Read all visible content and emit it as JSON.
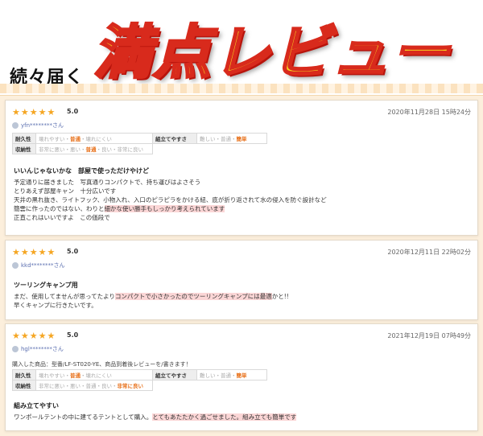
{
  "banner": {
    "lead": "続々届く",
    "title": "満点レビュー"
  },
  "reviews": [
    {
      "stars": "★★★★★",
      "rating": "5.0",
      "date": "2020年11月28日 15時24分",
      "user": "yfn********さん",
      "attributes": {
        "row1": {
          "label": "耐久性",
          "pre": "壊れやすい・",
          "selected": "普通",
          "post": "・壊れにくい",
          "label2": "組立てやすさ",
          "pre2": "難しい・普通・",
          "selected2": "簡単",
          "post2": ""
        },
        "row2": {
          "label": "収納性",
          "pre": "非常に悪い・悪い・",
          "selected": "普通",
          "post": "・良い・非常に良い"
        }
      },
      "body_title": "いいんじゃないかな　部屋で使っただけやけど",
      "lines": [
        "予定通りに届きました　写真通りコンパクトで、持ち運びはよさそう",
        "とりあえず部屋キャン　十分広いです",
        "天井の黒れ抜き、ライトフック、小物入れ、入口のピラピラをかける紐、底が折り返されて水の侵入を防ぐ設計など"
      ],
      "line4_pre": "簡雲に作ったのではない、わりと",
      "line4_hl": "細かな使い勝手もしっかり考えられています",
      "line5": "正直これはいいですよ　この価段で"
    },
    {
      "stars": "★★★★★",
      "rating": "5.0",
      "date": "2020年12月11日 22時02分",
      "user": "kkd********さん",
      "body_title": "ツーリングキャンプ用",
      "line1_pre": "まだ、使用してませんが思ってたより",
      "line1_hl": "コンパクトで小さかったのでツーリングキャンプには最適",
      "line1_post": "かと!!",
      "line2": "早くキャンプに行きたいです。"
    },
    {
      "stars": "★★★★★",
      "rating": "5.0",
      "date": "2021年12月19日 07時49分",
      "user": "hgl********さん",
      "purchased": "購入した商品：型番/LF-ST020-YE、商品到着後レビューを/書きます！",
      "attributes": {
        "row1": {
          "label": "耐久性",
          "pre": "壊れやすい・",
          "selected": "普通",
          "post": "・壊れにくい",
          "label2": "組立てやすさ",
          "pre2": "難しい・普通・",
          "selected2": "簡単",
          "post2": ""
        },
        "row2": {
          "label": "収納性",
          "pre": "非常に悪い・悪い・普通・良い・",
          "selected": "非常に良い",
          "post": ""
        }
      },
      "body_title": "組み立てやすい",
      "line1_pre": "ワンポールテントの中に建てるテントとして購入。",
      "line1_hl": "とてもあたたかく過ごせました。組み立ても簡単です"
    }
  ]
}
